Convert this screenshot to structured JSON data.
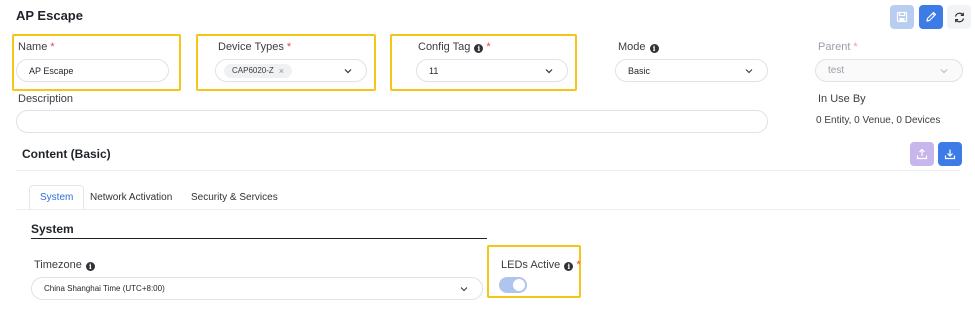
{
  "page": {
    "title": "AP Escape"
  },
  "toolbar": {
    "save_icon": "save-icon",
    "edit_icon": "edit-icon",
    "refresh_icon": "refresh-icon"
  },
  "form": {
    "name": {
      "label": "Name",
      "required": "*",
      "value": "AP  Escape"
    },
    "device_types": {
      "label": "Device Types",
      "required": "*",
      "selected_tag": "CAP6020-Z",
      "remove": "×"
    },
    "config_tag": {
      "label": "Config Tag",
      "required": "*",
      "value": "11"
    },
    "mode": {
      "label": "Mode",
      "value": "Basic"
    },
    "parent": {
      "label": "Parent",
      "required": "*",
      "value": "test"
    },
    "description": {
      "label": "Description",
      "value": ""
    },
    "in_use_by": {
      "label": "In Use By",
      "value": "0 Entity, 0 Venue, 0 Devices"
    }
  },
  "content": {
    "title": "Content (Basic)",
    "tabs": [
      {
        "label": "System",
        "active": true
      },
      {
        "label": "Network Activation",
        "active": false
      },
      {
        "label": "Security & Services",
        "active": false
      }
    ],
    "system": {
      "title": "System",
      "timezone": {
        "label": "Timezone",
        "value": "China Shanghai Time (UTC+8:00)"
      },
      "leds_active": {
        "label": "LEDs Active",
        "required": "*",
        "enabled": true
      }
    }
  },
  "colors": {
    "accent": "#3d7be6",
    "highlight": "#f5c518",
    "required": "#e5484d"
  }
}
